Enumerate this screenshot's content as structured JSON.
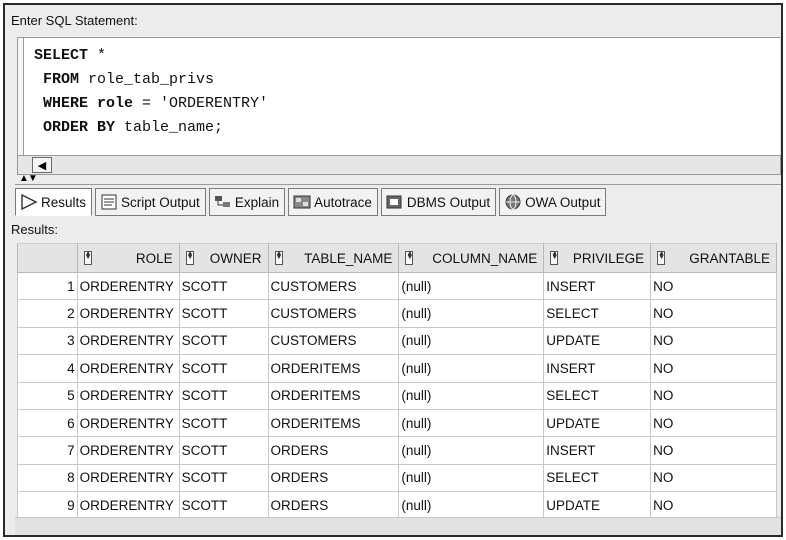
{
  "editor": {
    "label": "Enter SQL Statement:",
    "lines": [
      {
        "kw": "SELECT",
        "rest": " *"
      },
      {
        "kw": " FROM",
        "rest": " role_tab_privs"
      },
      {
        "kw": " WHERE role",
        "rest": " = 'ORDERENTRY'"
      },
      {
        "kw": " ORDER BY",
        "rest": " table_name;"
      }
    ]
  },
  "tabs": [
    {
      "label": "Results",
      "icon": "play-arrow-icon",
      "active": true
    },
    {
      "label": "Script Output",
      "icon": "script-icon"
    },
    {
      "label": "Explain",
      "icon": "explain-plan-icon"
    },
    {
      "label": "Autotrace",
      "icon": "autotrace-icon"
    },
    {
      "label": "DBMS Output",
      "icon": "dbms-output-icon"
    },
    {
      "label": "OWA Output",
      "icon": "owa-globe-icon"
    }
  ],
  "results": {
    "label": "Results:",
    "columns": [
      "ROLE",
      "OWNER",
      "TABLE_NAME",
      "COLUMN_NAME",
      "PRIVILEGE",
      "GRANTABLE"
    ],
    "rows": [
      [
        "1",
        "ORDERENTRY",
        "SCOTT",
        "CUSTOMERS",
        "(null)",
        "INSERT",
        "NO"
      ],
      [
        "2",
        "ORDERENTRY",
        "SCOTT",
        "CUSTOMERS",
        "(null)",
        "SELECT",
        "NO"
      ],
      [
        "3",
        "ORDERENTRY",
        "SCOTT",
        "CUSTOMERS",
        "(null)",
        "UPDATE",
        "NO"
      ],
      [
        "4",
        "ORDERENTRY",
        "SCOTT",
        "ORDERITEMS",
        "(null)",
        "INSERT",
        "NO"
      ],
      [
        "5",
        "ORDERENTRY",
        "SCOTT",
        "ORDERITEMS",
        "(null)",
        "SELECT",
        "NO"
      ],
      [
        "6",
        "ORDERENTRY",
        "SCOTT",
        "ORDERITEMS",
        "(null)",
        "UPDATE",
        "NO"
      ],
      [
        "7",
        "ORDERENTRY",
        "SCOTT",
        "ORDERS",
        "(null)",
        "INSERT",
        "NO"
      ],
      [
        "8",
        "ORDERENTRY",
        "SCOTT",
        "ORDERS",
        "(null)",
        "SELECT",
        "NO"
      ],
      [
        "9",
        "ORDERENTRY",
        "SCOTT",
        "ORDERS",
        "(null)",
        "UPDATE",
        "NO"
      ]
    ]
  }
}
